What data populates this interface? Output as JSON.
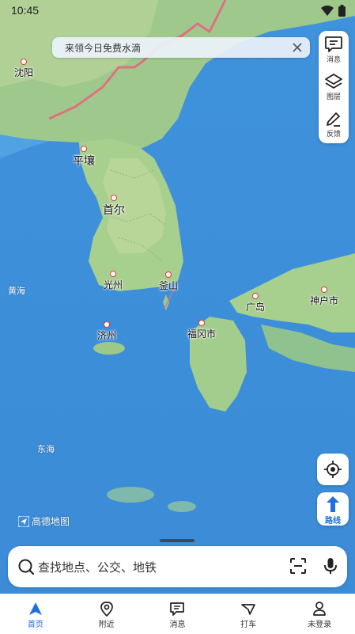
{
  "status_bar": {
    "time": "10:45"
  },
  "banner": {
    "text": "来领今日免费水滴"
  },
  "side_panel": {
    "messages_label": "消息",
    "layers_label": "图层",
    "feedback_label": "反馈"
  },
  "route_label": "路线",
  "logo_text": "高德地图",
  "search": {
    "placeholder": "查找地点、公交、地铁"
  },
  "bottom_nav": [
    {
      "label": "首页",
      "icon": "home-arrow-icon",
      "active": true
    },
    {
      "label": "附近",
      "icon": "location-pin-icon",
      "active": false
    },
    {
      "label": "消息",
      "icon": "message-icon",
      "active": false
    },
    {
      "label": "打车",
      "icon": "taxi-icon",
      "active": false
    },
    {
      "label": "未登录",
      "icon": "user-icon",
      "active": false
    }
  ],
  "map": {
    "cities": {
      "shenyang": "沈阳",
      "pyongyang": "平壤",
      "seoul": "首尔",
      "gwangju": "光州",
      "busan": "釜山",
      "jeju": "济州",
      "fukuoka": "福冈市",
      "hiroshima": "广岛",
      "kobe": "神户市"
    },
    "seas": {
      "yellow_sea": "黄海",
      "east_sea": "东海"
    }
  },
  "colors": {
    "accent": "#1f6fe0",
    "border_line": "#e07080",
    "city_dot": "#e53935"
  }
}
